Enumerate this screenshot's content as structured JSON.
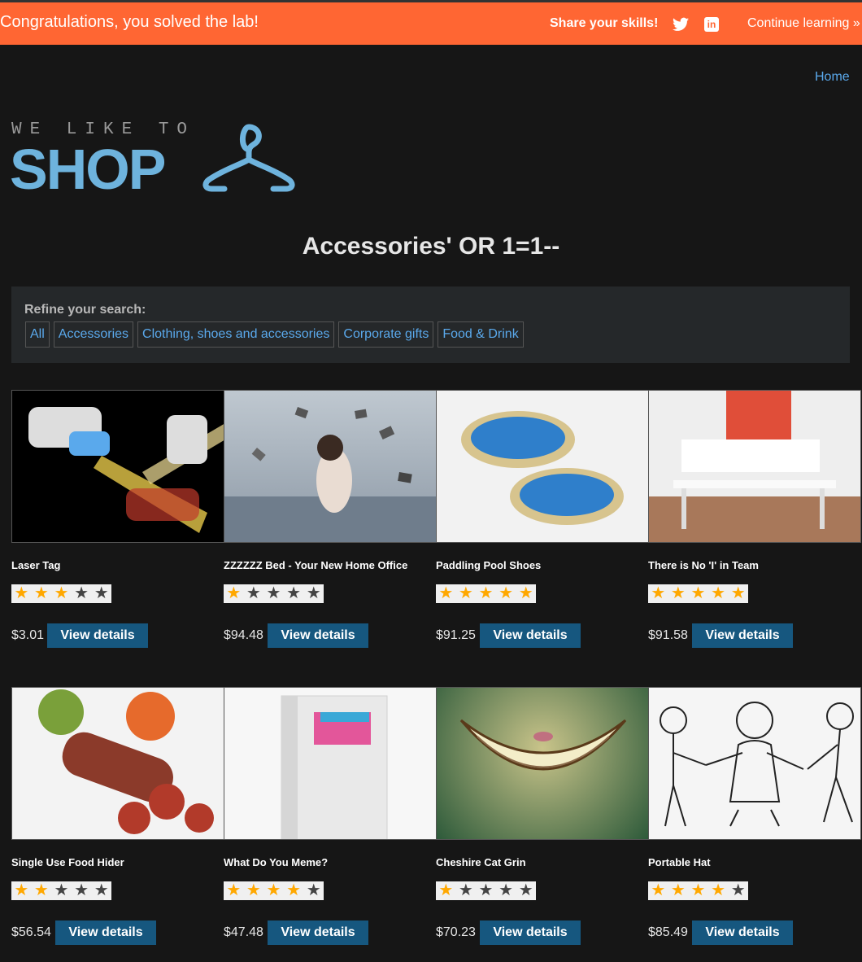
{
  "banner": {
    "title": "Congratulations, you solved the lab!",
    "share_label": "Share your skills!",
    "continue_label": "Continue learning",
    "continue_chevron": "»",
    "linkedin_text": "in"
  },
  "nav": {
    "home": "Home"
  },
  "logo": {
    "top": "WE LIKE TO",
    "main": "SHOP"
  },
  "search": {
    "heading": "Accessories' OR 1=1--"
  },
  "refine": {
    "label": "Refine your search:",
    "filters": [
      "All",
      "Accessories",
      "Clothing, shoes and accessories",
      "Corporate gifts",
      "Food & Drink"
    ]
  },
  "products": [
    {
      "name": "Laser Tag",
      "rating": 3,
      "price": "$3.01",
      "button": "View details"
    },
    {
      "name": "ZZZZZZ Bed - Your New Home Office",
      "rating": 1,
      "price": "$94.48",
      "button": "View details"
    },
    {
      "name": "Paddling Pool Shoes",
      "rating": 5,
      "price": "$91.25",
      "button": "View details"
    },
    {
      "name": "There is No 'I' in Team",
      "rating": 5,
      "price": "$91.58",
      "button": "View details"
    },
    {
      "name": "Single Use Food Hider",
      "rating": 2,
      "price": "$56.54",
      "button": "View details"
    },
    {
      "name": "What Do You Meme?",
      "rating": 4,
      "price": "$47.48",
      "button": "View details"
    },
    {
      "name": "Cheshire Cat Grin",
      "rating": 1,
      "price": "$70.23",
      "button": "View details"
    },
    {
      "name": "Portable Hat",
      "rating": 4,
      "price": "$85.49",
      "button": "View details"
    }
  ],
  "colors": {
    "banner": "#ff6633",
    "accent": "#5aa9ec",
    "button": "#16577f",
    "star": "#ffa800"
  },
  "icons": {
    "twitter": "twitter-icon",
    "linkedin": "linkedin-icon",
    "hanger": "hanger-icon",
    "star": "star-icon"
  }
}
